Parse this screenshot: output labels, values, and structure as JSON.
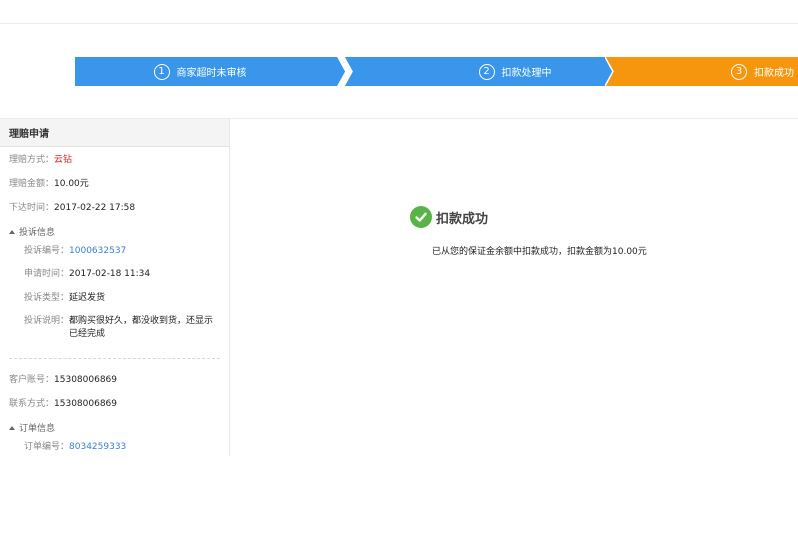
{
  "steps": [
    {
      "num": "1",
      "label": "商家超时未审核"
    },
    {
      "num": "2",
      "label": "扣款处理中"
    },
    {
      "num": "3",
      "label": "扣款成功"
    }
  ],
  "colors": {
    "step_active": "#3a96ea",
    "step_current": "#f6950e",
    "success": "#58b447",
    "link": "#3a7fd5",
    "highlight": "#e42020"
  },
  "panel": {
    "title": "理赔申请",
    "method_key": "理赔方式：",
    "method_val": "云钻",
    "amount_key": "理赔金额：",
    "amount_val": "10.00元",
    "time_key": "下达时间：",
    "time_val": "2017-02-22 17:58",
    "complaint_toggle": "投诉信息",
    "complaint_no_key": "投诉编号：",
    "complaint_no_val": "1000632537",
    "apply_time_key": "申请时间：",
    "apply_time_val": "2017-02-18 11:34",
    "type_key": "投诉类型：",
    "type_val": "延迟发货",
    "desc_key": "投诉说明：",
    "desc_val": "都购买很好久，都没收到货，还显示已经完成",
    "account_key": "客户账号：",
    "account_val": "15308006869",
    "contact_key": "联系方式：",
    "contact_val": "15308006869",
    "order_toggle": "订单信息",
    "order_no_key": "订单编号：",
    "order_no_val": "8034259333"
  },
  "result": {
    "icon": "check-circle-icon",
    "title": "扣款成功",
    "desc": "已从您的保证金余额中扣款成功，扣款金额为10.00元"
  }
}
